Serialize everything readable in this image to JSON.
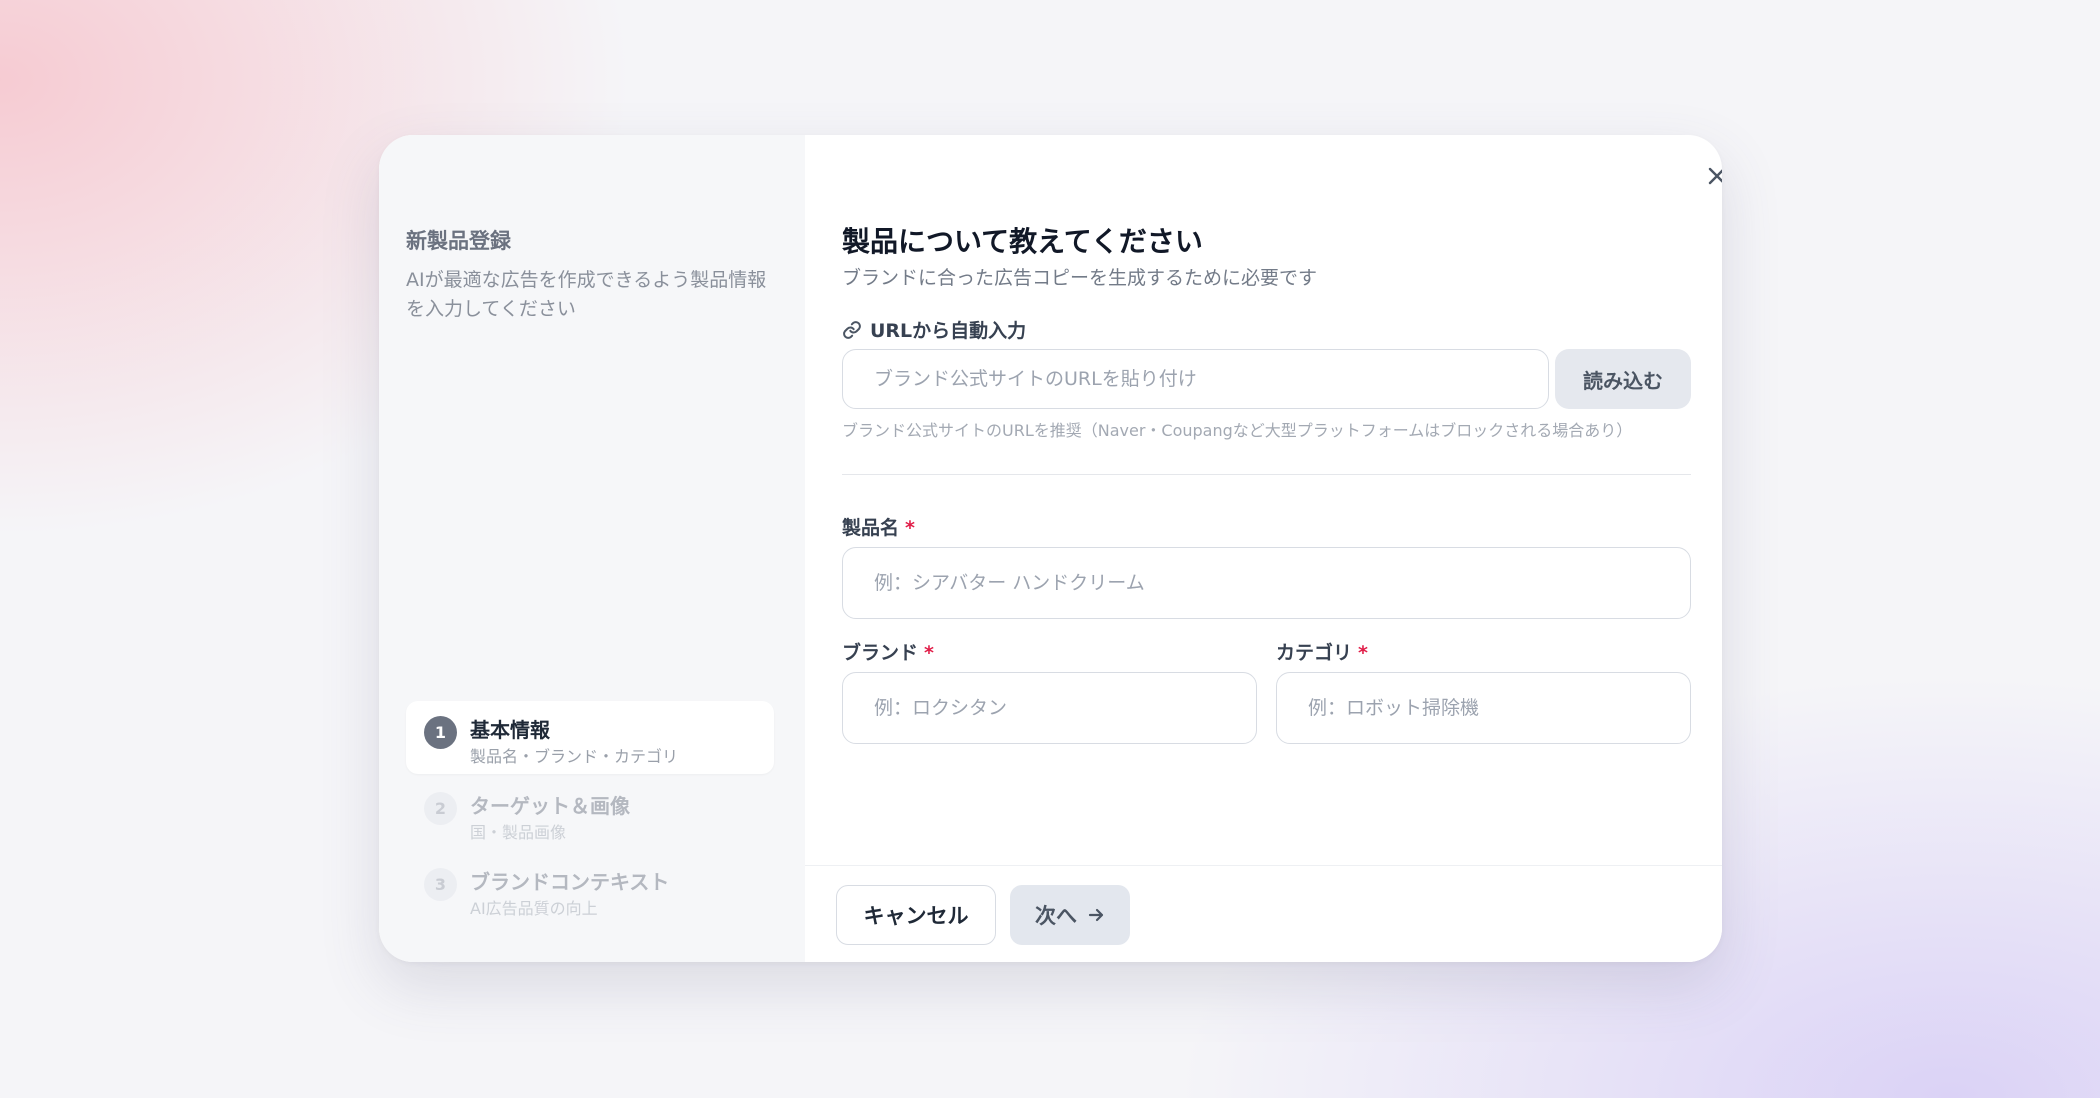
{
  "sidebar": {
    "title": "新製品登録",
    "description": "AIが最適な広告を作成できるよう製品情報を入力してください",
    "steps": [
      {
        "number": "1",
        "label": "基本情報",
        "sub": "製品名・ブランド・カテゴリ",
        "state": "active"
      },
      {
        "number": "2",
        "label": "ターゲット＆画像",
        "sub": "国・製品画像",
        "state": "inactive"
      },
      {
        "number": "3",
        "label": "ブランドコンテキスト",
        "sub": "AI広告品質の向上",
        "state": "inactive"
      }
    ]
  },
  "main": {
    "title": "製品について教えてください",
    "subtitle": "ブランドに合った広告コピーを生成するために必要です",
    "url_section": {
      "label": "URLから自動入力",
      "placeholder": "ブランド公式サイトのURLを貼り付け",
      "load_button": "読み込む",
      "hint": "ブランド公式サイトのURLを推奨（Naver・Coupangなど大型プラットフォームはブロックされる場合あり）"
    },
    "product_name": {
      "label": "製品名",
      "required_mark": "*",
      "placeholder": "例：シアバター ハンドクリーム"
    },
    "brand": {
      "label": "ブランド",
      "required_mark": "*",
      "placeholder": "例：ロクシタン"
    },
    "category": {
      "label": "カテゴリ",
      "required_mark": "*",
      "placeholder": "例：ロボット掃除機"
    }
  },
  "footer": {
    "cancel_label": "キャンセル",
    "next_label": "次へ"
  },
  "icons": {
    "close": "close-icon",
    "link": "link-icon",
    "arrow": "arrow-right-icon"
  },
  "colors": {
    "required": "#e11d48",
    "active_step": "#6b7280"
  }
}
